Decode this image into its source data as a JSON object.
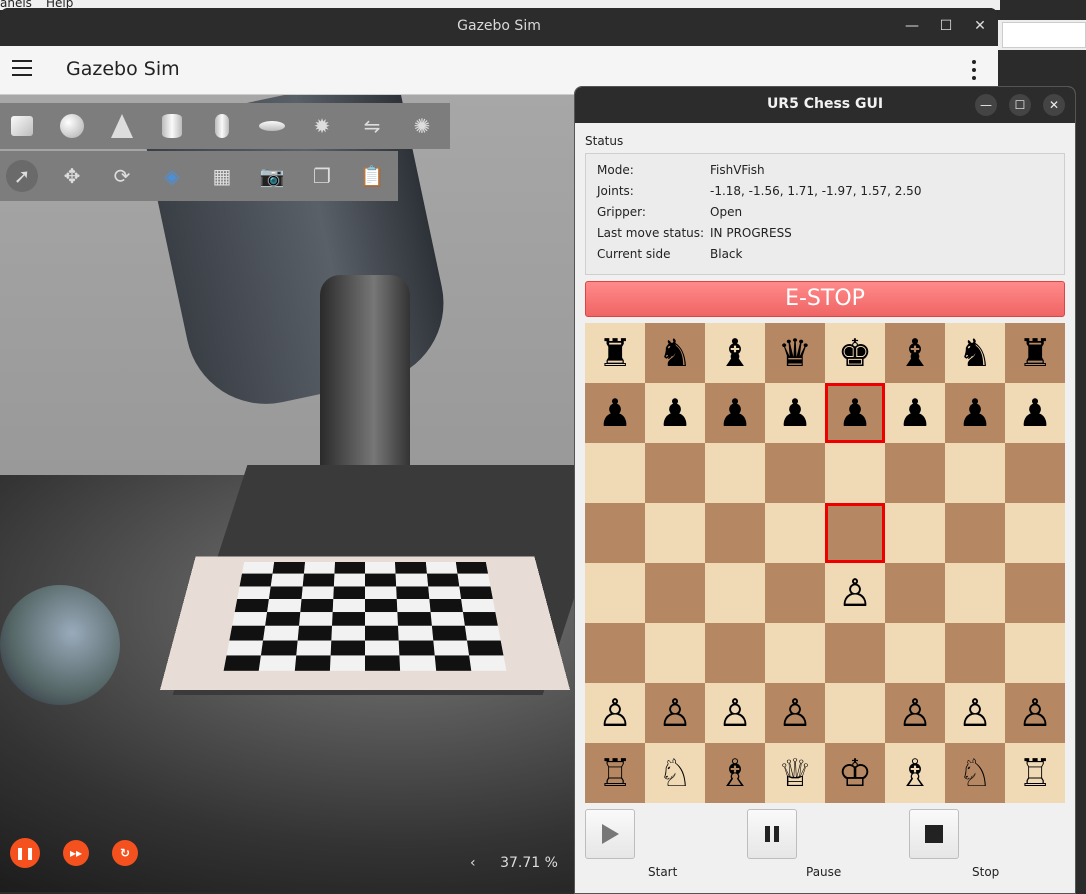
{
  "desktop": {
    "menu_left": "anels",
    "menu_help": "Help"
  },
  "gazebo": {
    "window_title": "Gazebo Sim",
    "app_title": "Gazebo Sim",
    "rtf": "37.71 %",
    "rtf_arrow": "‹",
    "window_controls": [
      "—",
      "☐",
      "✕"
    ]
  },
  "chess": {
    "window_title": "UR5 Chess GUI",
    "window_controls": [
      "—",
      "☐",
      "✕"
    ],
    "status_label": "Status",
    "status": [
      {
        "key": "Mode:",
        "value": "FishVFish"
      },
      {
        "key": "Joints:",
        "value": "-1.18, -1.56, 1.71, -1.97, 1.57, 2.50"
      },
      {
        "key": "Gripper:",
        "value": "Open"
      },
      {
        "key": "Last move status:",
        "value": "IN PROGRESS"
      },
      {
        "key": "Current side",
        "value": "Black"
      }
    ],
    "estop_label": "E-STOP",
    "board": [
      [
        "♜",
        "♞",
        "♝",
        "♛",
        "♚",
        "♝",
        "♞",
        "♜"
      ],
      [
        "♟",
        "♟",
        "♟",
        "♟",
        "♟",
        "♟",
        "♟",
        "♟"
      ],
      [
        "",
        "",
        "",
        "",
        "",
        "",
        "",
        ""
      ],
      [
        "",
        "",
        "",
        "",
        "",
        "",
        "",
        ""
      ],
      [
        "",
        "",
        "",
        "",
        "♙",
        "",
        "",
        ""
      ],
      [
        "",
        "",
        "",
        "",
        "",
        "",
        "",
        ""
      ],
      [
        "♙",
        "♙",
        "♙",
        "♙",
        "",
        "♙",
        "♙",
        "♙"
      ],
      [
        "♖",
        "♘",
        "♗",
        "♕",
        "♔",
        "♗",
        "♘",
        "♖"
      ]
    ],
    "highlighted_squares": [
      [
        1,
        4
      ],
      [
        3,
        4
      ]
    ],
    "controls": [
      {
        "label": "Start",
        "icon": "play-icon"
      },
      {
        "label": "Pause",
        "icon": "pause-icon"
      },
      {
        "label": "Stop",
        "icon": "stop-icon"
      }
    ],
    "colors": {
      "light_square": "#f0d9b5",
      "dark_square": "#b58863",
      "highlight": "#e00000",
      "estop": "#f06565"
    }
  }
}
